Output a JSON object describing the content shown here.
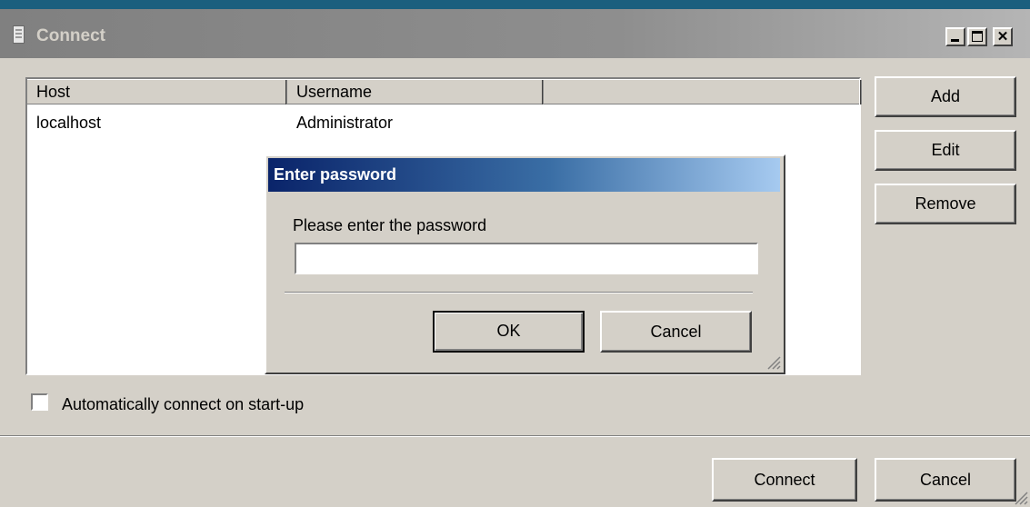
{
  "window": {
    "title": "Connect"
  },
  "list": {
    "columns": [
      "Host",
      "Username",
      ""
    ],
    "rows": [
      {
        "host": "localhost",
        "username": "Administrator"
      }
    ]
  },
  "side_buttons": {
    "add": "Add",
    "edit": "Edit",
    "remove": "Remove"
  },
  "auto_connect": {
    "label": "Automatically connect on start-up",
    "checked": false
  },
  "footer": {
    "connect": "Connect",
    "cancel": "Cancel"
  },
  "password_dialog": {
    "title": "Enter password",
    "prompt": "Please enter the password",
    "password_value": "",
    "ok": "OK",
    "cancel": "Cancel"
  }
}
